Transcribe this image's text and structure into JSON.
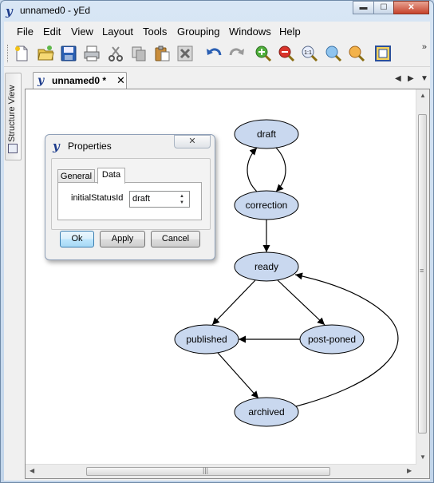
{
  "window": {
    "title": "unnamed0 - yEd",
    "logo_glyph": "y",
    "minimize_glyph": "▬",
    "maximize_glyph": "☐",
    "close_glyph": "✕"
  },
  "menu": [
    "File",
    "Edit",
    "View",
    "Layout",
    "Tools",
    "Grouping",
    "Windows",
    "Help"
  ],
  "toolbar": {
    "buttons": [
      "new-document-icon",
      "open-folder-icon",
      "save-icon",
      "print-icon",
      "cut-icon",
      "copy-icon",
      "paste-icon",
      "delete-icon",
      "undo-icon",
      "redo-icon",
      "zoom-in-icon",
      "zoom-out-icon",
      "zoom-actual-size-icon",
      "zoom-to-fit-icon",
      "zoom-to-selection-icon",
      "fit-content-icon"
    ],
    "zoom_actual_label": "1:1",
    "overflow_glyph": "»"
  },
  "side_panel": {
    "tab_label": "Structure View"
  },
  "document_tab": {
    "label": "unnamed0 *",
    "close_glyph": "✕"
  },
  "tab_nav": {
    "left": "◀",
    "right": "▶",
    "list": "▼"
  },
  "graph": {
    "nodes": [
      {
        "id": "draft",
        "label": "draft"
      },
      {
        "id": "correction",
        "label": "correction"
      },
      {
        "id": "ready",
        "label": "ready"
      },
      {
        "id": "published",
        "label": "published"
      },
      {
        "id": "post-poned",
        "label": "post-poned"
      },
      {
        "id": "archived",
        "label": "archived"
      }
    ],
    "edges": [
      {
        "from": "draft",
        "to": "correction"
      },
      {
        "from": "correction",
        "to": "draft"
      },
      {
        "from": "correction",
        "to": "ready"
      },
      {
        "from": "ready",
        "to": "published"
      },
      {
        "from": "ready",
        "to": "post-poned"
      },
      {
        "from": "post-poned",
        "to": "published"
      },
      {
        "from": "published",
        "to": "archived"
      },
      {
        "from": "archived",
        "to": "ready"
      }
    ],
    "node_fill": "#c9d8ef",
    "node_stroke": "#000000"
  },
  "properties_dialog": {
    "title": "Properties",
    "close_glyph": "✕",
    "tabs": [
      {
        "label": "General",
        "active": false
      },
      {
        "label": "Data",
        "active": true
      }
    ],
    "field_label": "initialStatusId",
    "field_value": "draft",
    "buttons": {
      "ok": "Ok",
      "apply": "Apply",
      "cancel": "Cancel"
    }
  },
  "scrollbar": {
    "up": "▲",
    "down": "▼",
    "left": "◀",
    "right": "▶",
    "grip_h": "|||",
    "grip_v": "≡"
  }
}
